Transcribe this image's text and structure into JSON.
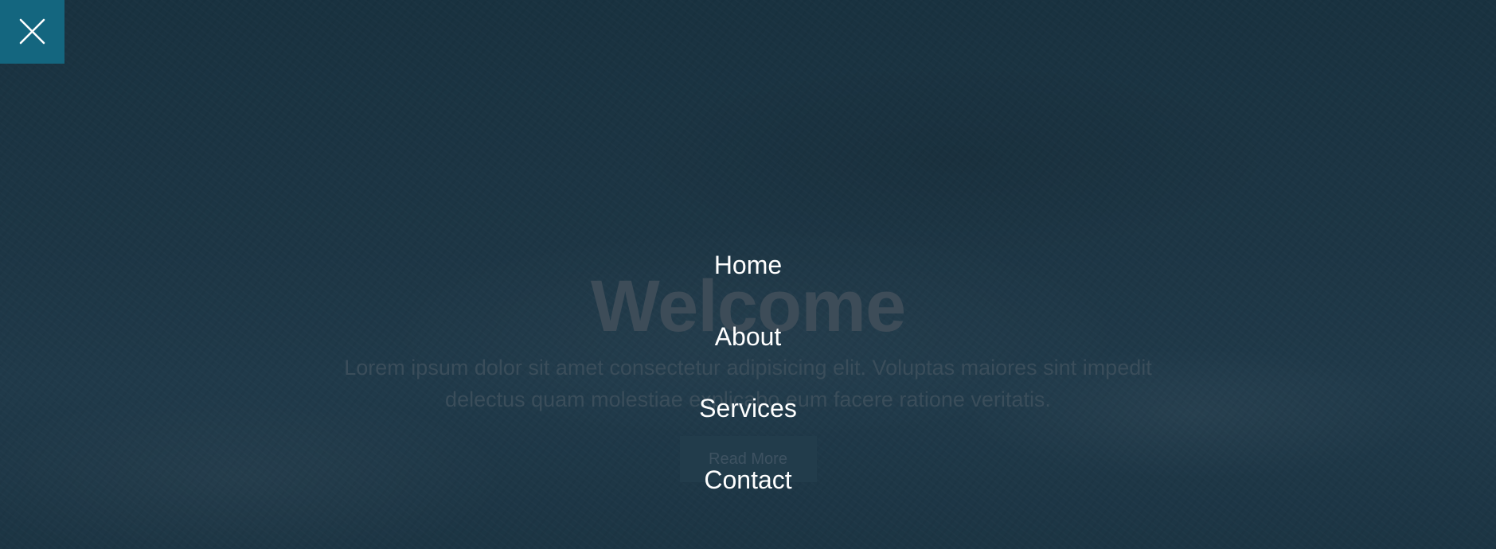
{
  "hero": {
    "title": "Welcome",
    "text": "Lorem ipsum dolor sit amet consectetur adipisicing elit. Voluptas maiores sint impedit delectus quam molestiae explicabo eum facere ratione veritatis.",
    "button_label": "Read More"
  },
  "menu": {
    "close_icon": "close-icon",
    "items": [
      {
        "label": "Home"
      },
      {
        "label": "About"
      },
      {
        "label": "Services"
      },
      {
        "label": "Contact"
      }
    ]
  },
  "colors": {
    "background": "#1b3442",
    "close_button": "#14667f",
    "menu_text": "#ffffff"
  }
}
